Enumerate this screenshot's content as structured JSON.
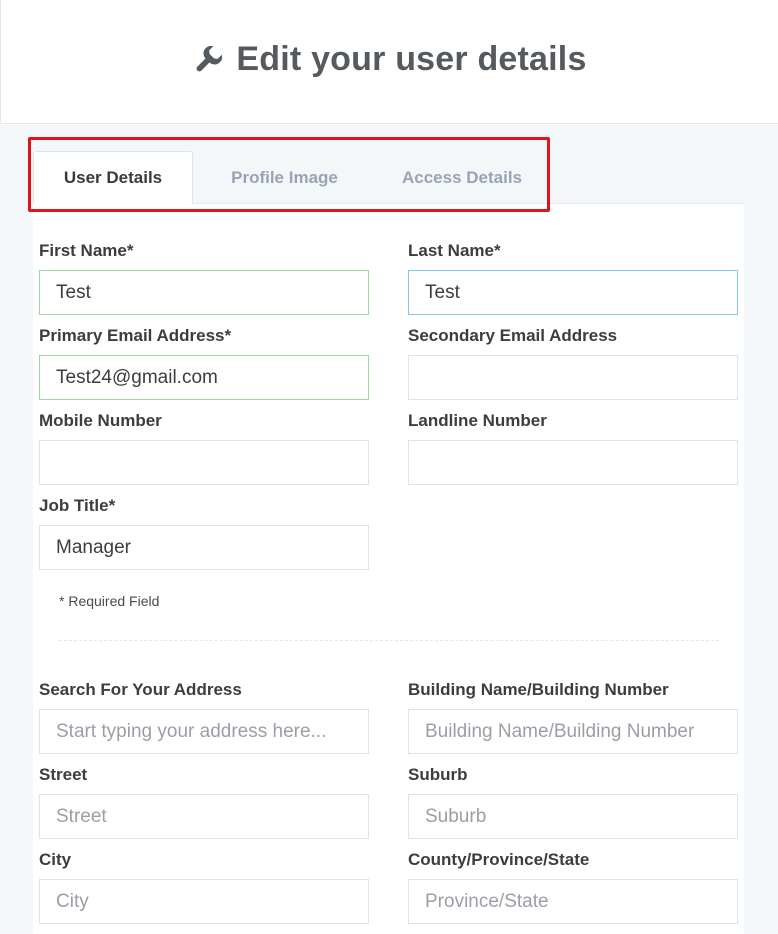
{
  "header": {
    "title": "Edit your user details",
    "icon": "wrench-icon"
  },
  "tabs": [
    {
      "label": "User Details",
      "active": true
    },
    {
      "label": "Profile Image",
      "active": false
    },
    {
      "label": "Access Details",
      "active": false
    }
  ],
  "form": {
    "first_name": {
      "label": "First Name*",
      "value": "Test"
    },
    "last_name": {
      "label": "Last Name*",
      "value": "Test"
    },
    "primary_email": {
      "label": "Primary Email Address*",
      "value": "Test24@gmail.com"
    },
    "secondary_email": {
      "label": "Secondary Email Address",
      "value": ""
    },
    "mobile": {
      "label": "Mobile Number",
      "value": ""
    },
    "landline": {
      "label": "Landline Number",
      "value": ""
    },
    "job_title": {
      "label": "Job Title*",
      "value": "Manager"
    },
    "required_note": "* Required Field"
  },
  "address": {
    "search": {
      "label": "Search For Your Address",
      "placeholder": "Start typing your address here..."
    },
    "building": {
      "label": "Building Name/Building Number",
      "placeholder": "Building Name/Building Number"
    },
    "street": {
      "label": "Street",
      "placeholder": "Street"
    },
    "suburb": {
      "label": "Suburb",
      "placeholder": "Suburb"
    },
    "city": {
      "label": "City",
      "placeholder": "City"
    },
    "province": {
      "label": "County/Province/State",
      "placeholder": "Province/State"
    }
  },
  "colors": {
    "highlight": "#e0141a",
    "valid_border": "#9cd6a0",
    "focus_border": "#84c6e8",
    "active_tab_text": "#3a3a3a",
    "inactive_tab_text": "#9aa3b4"
  }
}
